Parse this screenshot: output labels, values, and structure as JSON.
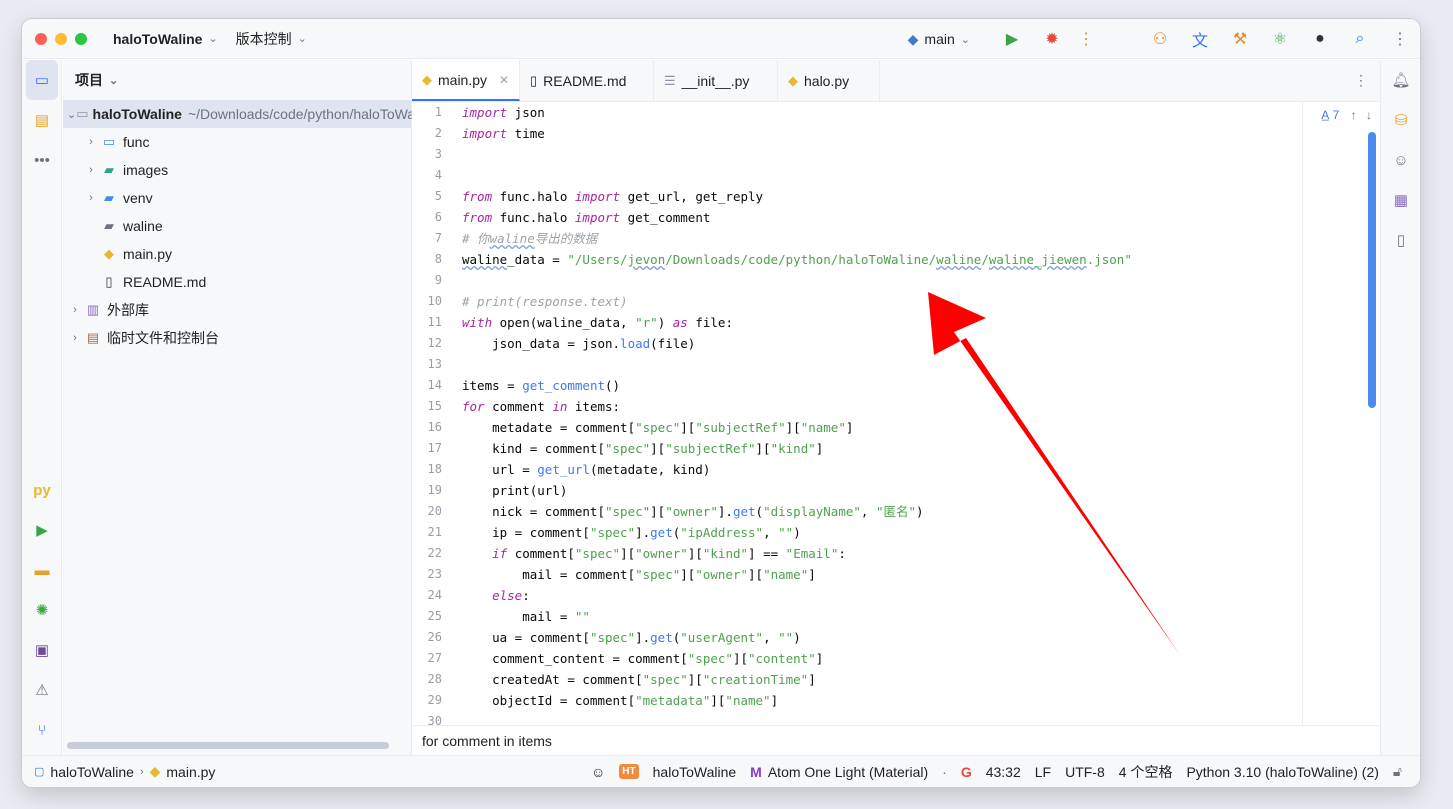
{
  "titlebar": {
    "project": "haloToWaline",
    "vcs": "版本控制",
    "branch": "main"
  },
  "project_panel": {
    "title": "项目",
    "root_name": "haloToWaline",
    "root_path": "~/Downloads/code/python/haloToWal",
    "items": [
      {
        "label": "func",
        "icon": "folder-icon"
      },
      {
        "label": "images",
        "icon": "folder-images-icon"
      },
      {
        "label": "venv",
        "icon": "folder-venv-icon"
      },
      {
        "label": "waline",
        "icon": "folder-icon"
      },
      {
        "label": "main.py",
        "icon": "python-file-icon"
      },
      {
        "label": "README.md",
        "icon": "markdown-file-icon"
      }
    ],
    "external": "外部库",
    "scratches": "临时文件和控制台"
  },
  "tabs": [
    {
      "label": "main.py",
      "active": true
    },
    {
      "label": "README.md",
      "active": false
    },
    {
      "label": "__init__.py",
      "active": false
    },
    {
      "label": "halo.py",
      "active": false
    }
  ],
  "editor": {
    "inspection_count": "7",
    "breadcrumb": "for comment in items",
    "line_numbers": [
      "1",
      "2",
      "3",
      "4",
      "5",
      "6",
      "7",
      "8",
      "9",
      "10",
      "11",
      "12",
      "13",
      "14",
      "15",
      "16",
      "17",
      "18",
      "19",
      "20",
      "21",
      "22",
      "23",
      "24",
      "25",
      "26",
      "27",
      "28",
      "29",
      "30"
    ]
  },
  "status": {
    "project": "haloToWaline",
    "file": "main.py",
    "ht_badge": "HT",
    "theme_project": "haloToWaline",
    "theme": "Atom One Light (Material)",
    "position": "43:32",
    "line_sep": "LF",
    "encoding": "UTF-8",
    "indent": "4 个空格",
    "interpreter": "Python 3.10 (haloToWaline) (2)"
  },
  "annotation": {
    "color": "#ff0000"
  }
}
